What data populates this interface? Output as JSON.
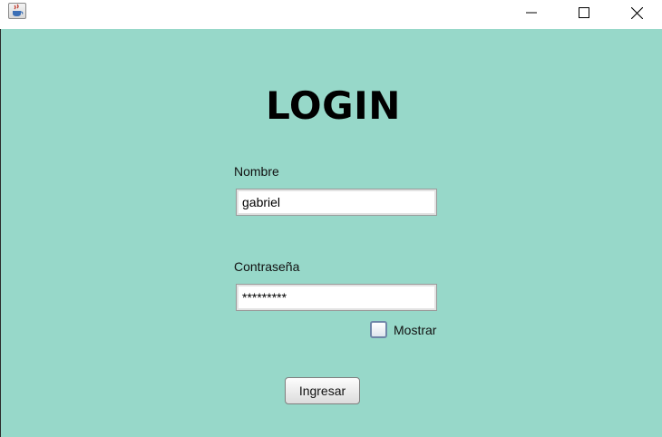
{
  "window": {
    "icons": {
      "app": "java-cup-icon",
      "minimize": "minimize-icon",
      "maximize": "maximize-icon",
      "close": "close-icon"
    }
  },
  "form": {
    "title": "LOGIN",
    "name_label": "Nombre",
    "name_value": "gabriel",
    "password_label": "Contraseña",
    "password_value": "*********",
    "show_label": "Mostrar",
    "show_checked": false,
    "submit_label": "Ingresar"
  },
  "colors": {
    "background": "#97d8c9"
  }
}
